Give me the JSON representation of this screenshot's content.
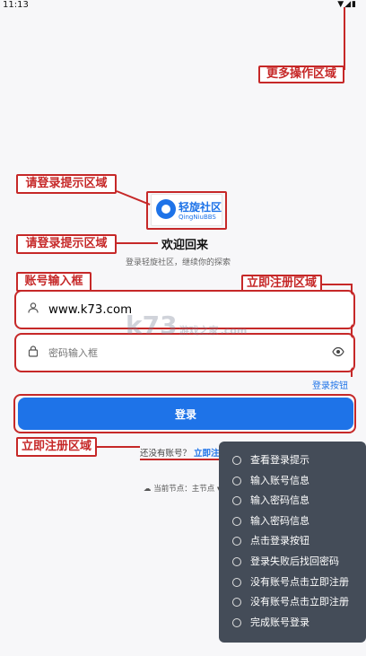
{
  "statusbar": {
    "time": "11:13",
    "icons": "▼◢▮"
  },
  "annotations": {
    "more_ops": "更多操作区域",
    "login_hint_1": "请登录提示区域",
    "login_hint_2": "请登录提示区域",
    "account_input": "账号输入框",
    "register_area_top": "立即注册区域",
    "login_button": "登录按钮",
    "register_area_bottom": "立即注册区域"
  },
  "logo": {
    "name_cn": "轻旋社区",
    "name_en": "QingNiuBBS"
  },
  "header": {
    "welcome": "欢迎回来",
    "subtitle": "登录轻旋社区，继续你的探索"
  },
  "form": {
    "account_value": "www.k73.com",
    "password_placeholder": "密码输入框",
    "submit": "登录"
  },
  "register": {
    "prompt": "还没有账号？",
    "link": "立即注册"
  },
  "node": {
    "label": "当前节点：主节点",
    "chevron": "▾"
  },
  "watermark": {
    "main": "k73",
    "sub": "游戏之家",
    "domain": ".com"
  },
  "menu": {
    "items": [
      "查看登录提示",
      "输入账号信息",
      "输入密码信息",
      "输入密码信息",
      "点击登录按钮",
      "登录失败后找回密码",
      "没有账号点击立即注册",
      "没有账号点击立即注册",
      "完成账号登录"
    ]
  },
  "colors": {
    "accent": "#1e73e8",
    "annotation": "#c62828",
    "menu_bg": "#444c58"
  },
  "icons": [
    "user-icon",
    "lock-icon",
    "eye-icon",
    "cloud-icon",
    "wifi-icon",
    "signal-icon",
    "battery-icon"
  ]
}
